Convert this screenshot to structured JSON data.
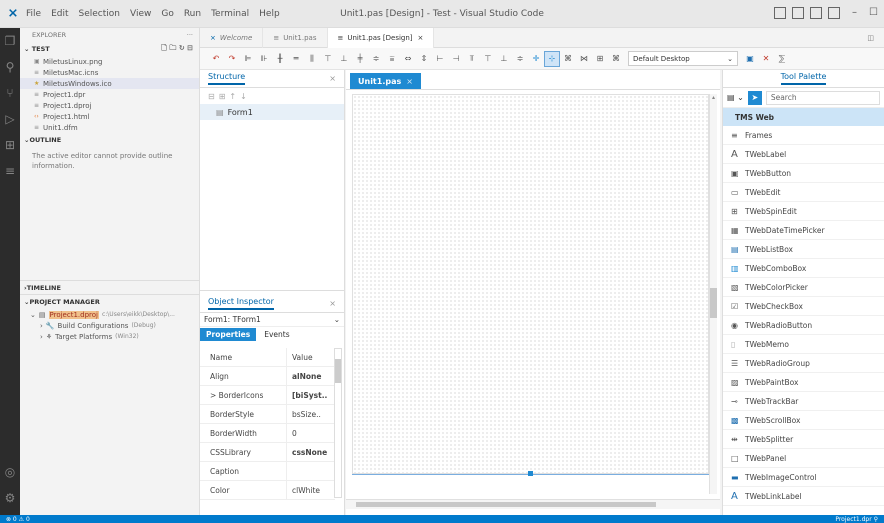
{
  "titlebar": {
    "app_icon": "vscode-logo-icon",
    "menu": [
      "File",
      "Edit",
      "Selection",
      "View",
      "Go",
      "Run",
      "Terminal",
      "Help"
    ],
    "title": "Unit1.pas [Design] - Test - Visual Studio Code"
  },
  "tabs": [
    {
      "label": "Welcome",
      "icon": "vscode-logo-icon"
    },
    {
      "label": "Unit1.pas",
      "icon": "file-icon"
    },
    {
      "label": "Unit1.pas [Design]",
      "icon": "file-icon",
      "close": "×"
    }
  ],
  "explorer": {
    "title": "EXPLORER",
    "more": "···",
    "folder": "TEST",
    "files": [
      "MiletusLinux.png",
      "MiletusMac.icns",
      "MiletusWindows.ico",
      "Project1.dpr",
      "Project1.dproj",
      "Project1.html",
      "Unit1.dfm"
    ],
    "outline_header": "OUTLINE",
    "outline_message": "The active editor cannot provide outline information.",
    "timeline_header": "TIMELINE",
    "project_manager_header": "PROJECT MANAGER",
    "project_name": "Project1.dproj",
    "project_path": "c:\\Users\\eikk\\Desktop\\...",
    "build_configurations": "Build Configurations",
    "build_config_value": "(Debug)",
    "target_platforms": "Target Platforms",
    "target_platforms_value": "(Win32)"
  },
  "structure": {
    "tab_label": "Structure",
    "close": "×",
    "tree_item": "Form1"
  },
  "inspector": {
    "tab_label": "Object Inspector",
    "close": "×",
    "selector": "Form1: TForm1",
    "tab_properties": "Properties",
    "tab_events": "Events",
    "col_name": "Name",
    "col_value": "Value",
    "rows": [
      {
        "name": "Align",
        "value": "alNone",
        "bold": true
      },
      {
        "name": "> BorderIcons",
        "value": "[biSyst..",
        "bold": true
      },
      {
        "name": "BorderStyle",
        "value": "bsSize..",
        "bold": false
      },
      {
        "name": "BorderWidth",
        "value": "0",
        "bold": false
      },
      {
        "name": "CSSLibrary",
        "value": "cssNone",
        "bold": true
      },
      {
        "name": "Caption",
        "value": "",
        "bold": false
      },
      {
        "name": "Color",
        "value": "clWhite",
        "bold": false
      }
    ]
  },
  "toolbar": {
    "platform_select": "Default Desktop"
  },
  "design": {
    "tab_label": "Unit1.pas",
    "tab_close": "×"
  },
  "palette": {
    "title": "Tool Palette",
    "search_placeholder": "Search",
    "category": "TMS Web",
    "items": [
      {
        "label": "Frames",
        "icon": "≡"
      },
      {
        "label": "TWebLabel",
        "icon": "A"
      },
      {
        "label": "TWebButton",
        "icon": "▣"
      },
      {
        "label": "TWebEdit",
        "icon": "▭"
      },
      {
        "label": "TWebSpinEdit",
        "icon": "⊞"
      },
      {
        "label": "TWebDateTimePicker",
        "icon": "▦"
      },
      {
        "label": "TWebListBox",
        "icon": "▤"
      },
      {
        "label": "TWebComboBox",
        "icon": "▥"
      },
      {
        "label": "TWebColorPicker",
        "icon": "▧"
      },
      {
        "label": "TWebCheckBox",
        "icon": "☑"
      },
      {
        "label": "TWebRadioButton",
        "icon": "◉"
      },
      {
        "label": "TWebMemo",
        "icon": "▯"
      },
      {
        "label": "TWebRadioGroup",
        "icon": "☰"
      },
      {
        "label": "TWebPaintBox",
        "icon": "▨"
      },
      {
        "label": "TWebTrackBar",
        "icon": "⊸"
      },
      {
        "label": "TWebScrollBox",
        "icon": "▩"
      },
      {
        "label": "TWebSplitter",
        "icon": "⇹"
      },
      {
        "label": "TWebPanel",
        "icon": "□"
      },
      {
        "label": "TWebImageControl",
        "icon": "▬"
      },
      {
        "label": "TWebLinkLabel",
        "icon": "A"
      }
    ]
  },
  "statusbar": {
    "left": "⊗ 0 ⚠ 0",
    "right": "Project1.dpr"
  }
}
